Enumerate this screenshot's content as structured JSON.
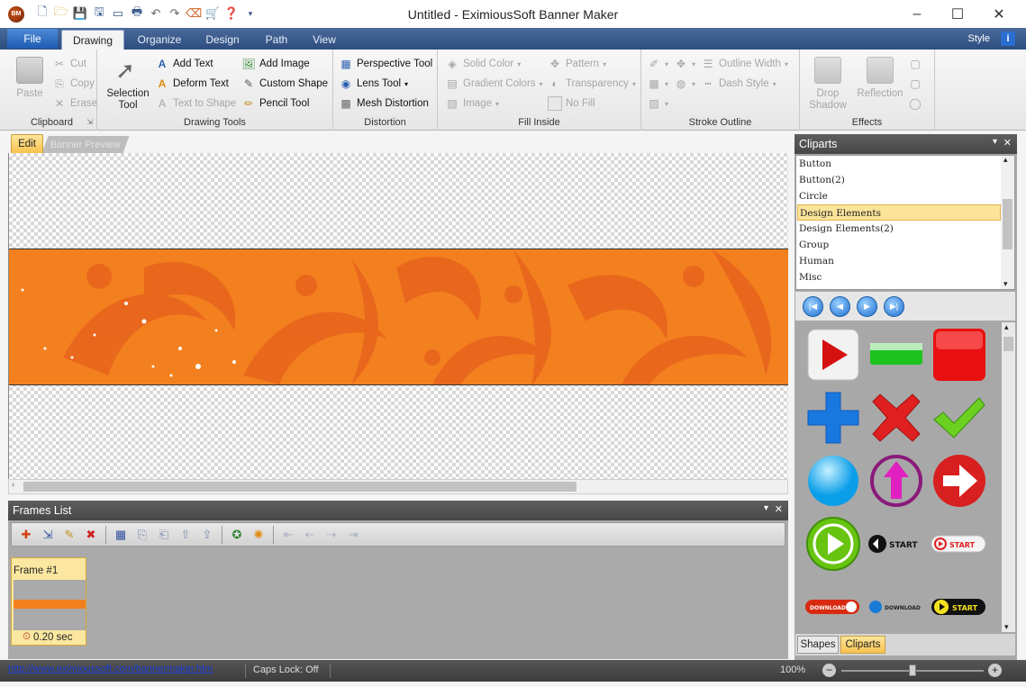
{
  "app": {
    "logo_text": "BM",
    "window_title": "Untitled - EximiousSoft Banner Maker"
  },
  "quick_access": [
    "new-icon",
    "open-icon",
    "save-icon",
    "save-as-icon",
    "export-icon",
    "print-icon",
    "undo-icon",
    "redo-icon",
    "clear-icon",
    "shop-icon",
    "help-icon"
  ],
  "window_controls": {
    "minimize": "–",
    "maximize": "☐",
    "close": "✕"
  },
  "ribbon_tabs": {
    "file": "File",
    "tabs": [
      "Drawing",
      "Organize",
      "Design",
      "Path",
      "View"
    ],
    "active": "Drawing",
    "style_label": "Style",
    "help_glyph": "i"
  },
  "clipboard": {
    "label": "Clipboard",
    "paste": "Paste",
    "cut": "Cut",
    "copy": "Copy",
    "erase": "Erase"
  },
  "drawing_tools": {
    "label": "Drawing Tools",
    "selection_tool": "Selection Tool",
    "add_text": "Add Text",
    "deform_text": "Deform Text",
    "text_to_shape": "Text to Shape",
    "add_image": "Add Image",
    "custom_shape": "Custom Shape",
    "pencil_tool": "Pencil Tool"
  },
  "distortion": {
    "label": "Distortion",
    "perspective_tool": "Perspective Tool",
    "lens_tool": "Lens Tool",
    "mesh_distortion": "Mesh Distortion"
  },
  "fill_inside": {
    "label": "Fill Inside",
    "solid_color": "Solid Color",
    "gradient_colors": "Gradient Colors",
    "image": "Image",
    "pattern": "Pattern",
    "transparency": "Transparency",
    "no_fill": "No Fill"
  },
  "stroke_outline": {
    "label": "Stroke Outline",
    "outline_width": "Outline Width",
    "dash_style": "Dash Style"
  },
  "effects": {
    "label": "Effects",
    "drop_shadow": "Drop Shadow",
    "reflection": "Reflection"
  },
  "document_tabs": {
    "edit": "Edit",
    "preview": "Banner Preview"
  },
  "colors": {
    "banner_orange": "#f3801f",
    "banner_pattern": "#e8651c",
    "selection_yellow": "#fbe39a",
    "status_link": "#1a3ad6"
  },
  "frames_list": {
    "title": "Frames List",
    "toolbar_icons": [
      "add-frame-icon",
      "insert-frame-icon",
      "edit-frame-icon",
      "delete-frame-icon",
      "select-all-icon",
      "copy-frame-icon",
      "paste-frame-icon",
      "move-up-icon",
      "export-frame-icon",
      "play-icon",
      "timer-icon",
      "first-frame-icon",
      "prev-frame-icon",
      "next-frame-icon",
      "last-frame-icon"
    ],
    "frames": [
      {
        "title": "Frame #1",
        "duration": "0.20 sec"
      }
    ]
  },
  "cliparts": {
    "title": "Cliparts",
    "categories": [
      "Button",
      "Button(2)",
      "Circle",
      "Design Elements",
      "Design Elements(2)",
      "Group",
      "Human",
      "Misc"
    ],
    "selected": "Design Elements",
    "nav_buttons": [
      "first-icon",
      "prev-icon",
      "next-icon",
      "last-icon"
    ],
    "items": [
      {
        "name": "play-red-button-icon"
      },
      {
        "name": "green-bar-button-icon"
      },
      {
        "name": "red-square-button-icon"
      },
      {
        "name": "blue-plus-icon"
      },
      {
        "name": "red-x-icon"
      },
      {
        "name": "green-check-icon"
      },
      {
        "name": "blue-circle-icon"
      },
      {
        "name": "pink-up-arrow-icon"
      },
      {
        "name": "red-right-arrow-icon"
      },
      {
        "name": "green-play-circle-icon"
      },
      {
        "name": "black-start-icon",
        "text": "START"
      },
      {
        "name": "red-start-pill-icon",
        "text": "START"
      },
      {
        "name": "red-download-pill-icon",
        "text": "DOWNLOAD"
      },
      {
        "name": "blue-download-icon",
        "text": "DOWNLOAD"
      },
      {
        "name": "yellow-start-pill-icon",
        "text": "START"
      }
    ],
    "bottom_tabs": [
      "Shapes",
      "Cliparts"
    ],
    "active_tab": "Cliparts"
  },
  "status": {
    "url": "http://www.eximioussoft.com/bannermaker.htm",
    "caps_lock": "Caps Lock: Off",
    "zoom": "100%",
    "zoom_slider_fraction": 0.5
  }
}
